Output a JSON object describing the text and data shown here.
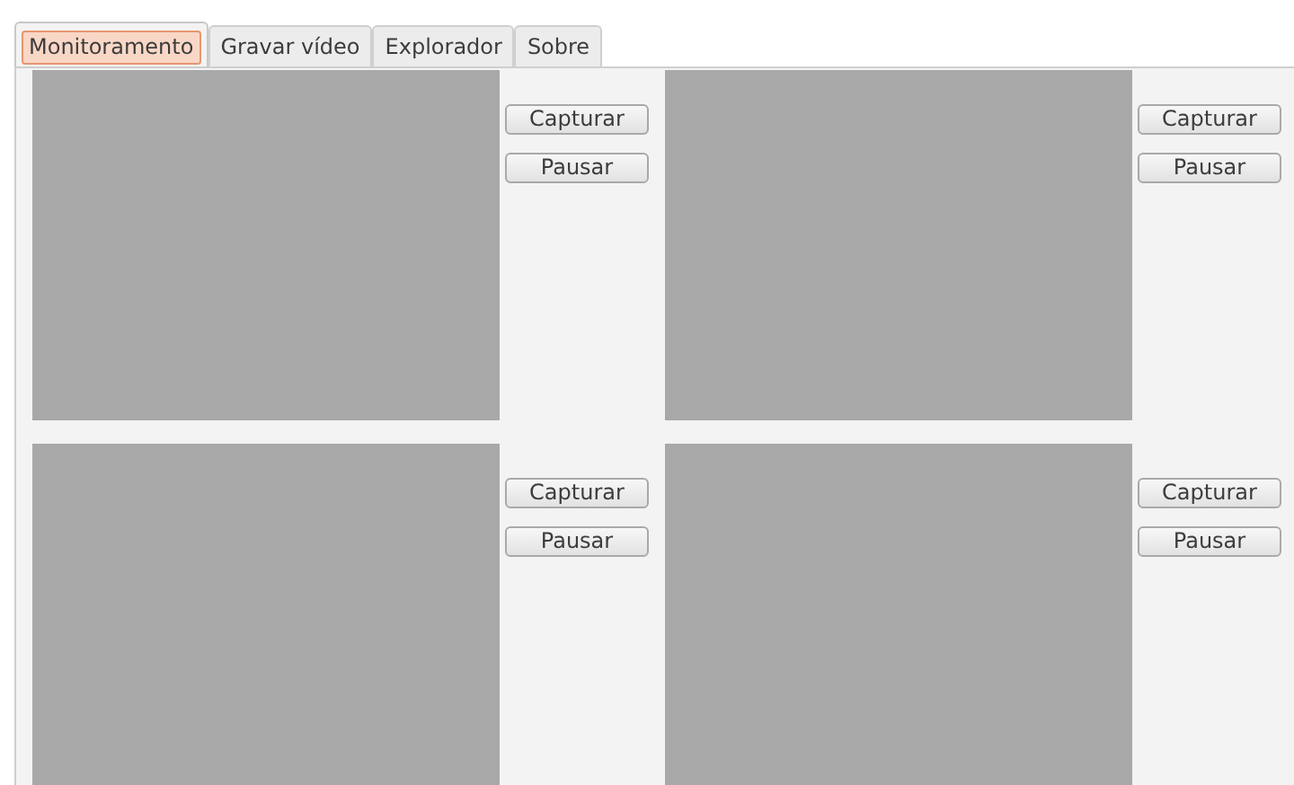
{
  "tabs": [
    {
      "label": "Monitoramento",
      "selected": true
    },
    {
      "label": "Gravar vídeo",
      "selected": false
    },
    {
      "label": "Explorador",
      "selected": false
    },
    {
      "label": "Sobre",
      "selected": false
    }
  ],
  "cameras": [
    {
      "buttons": [
        "Capturar",
        "Pausar"
      ]
    },
    {
      "buttons": [
        "Capturar",
        "Pausar"
      ]
    },
    {
      "buttons": [
        "Capturar",
        "Pausar"
      ]
    },
    {
      "buttons": [
        "Capturar",
        "Pausar"
      ]
    }
  ]
}
